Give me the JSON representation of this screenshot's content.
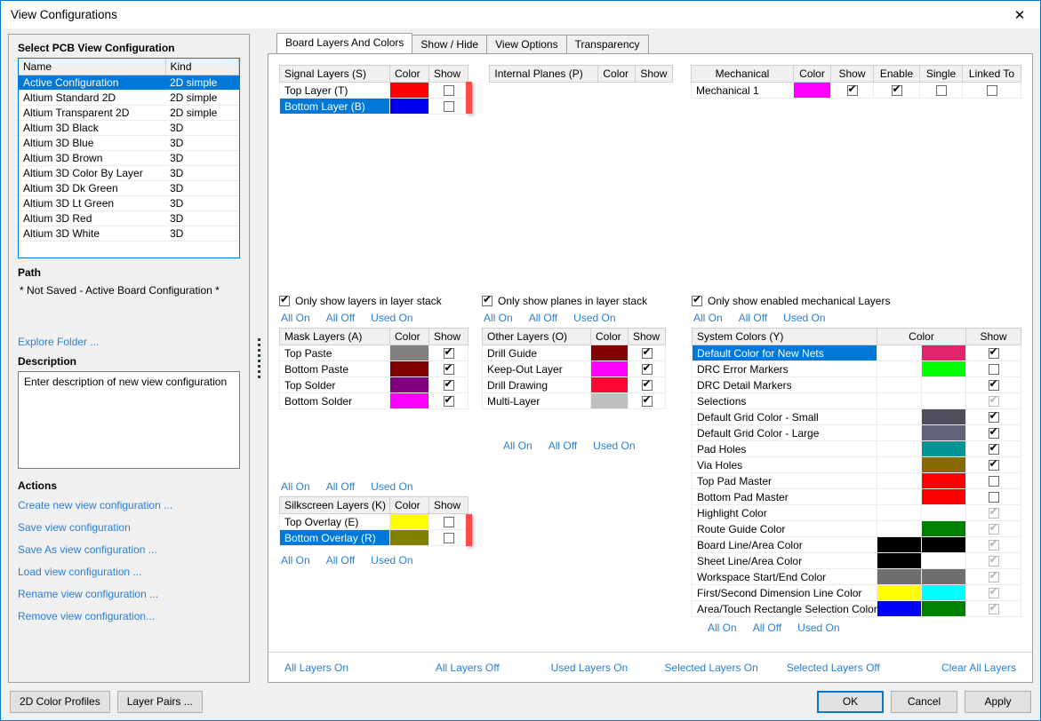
{
  "window": {
    "title": "View Configurations",
    "close_icon": "close-icon"
  },
  "left": {
    "select_label": "Select PCB View Configuration",
    "columns": [
      "Name",
      "Kind"
    ],
    "configs": [
      {
        "name": "Active Configuration",
        "kind": "2D simple",
        "selected": true
      },
      {
        "name": "Altium Standard 2D",
        "kind": "2D simple",
        "selected": false
      },
      {
        "name": "Altium Transparent 2D",
        "kind": "2D simple",
        "selected": false
      },
      {
        "name": "Altium 3D Black",
        "kind": "3D",
        "selected": false
      },
      {
        "name": "Altium 3D Blue",
        "kind": "3D",
        "selected": false
      },
      {
        "name": "Altium 3D Brown",
        "kind": "3D",
        "selected": false
      },
      {
        "name": "Altium 3D Color By Layer",
        "kind": "3D",
        "selected": false
      },
      {
        "name": "Altium 3D Dk Green",
        "kind": "3D",
        "selected": false
      },
      {
        "name": "Altium 3D Lt Green",
        "kind": "3D",
        "selected": false
      },
      {
        "name": "Altium 3D Red",
        "kind": "3D",
        "selected": false
      },
      {
        "name": "Altium 3D White",
        "kind": "3D",
        "selected": false
      }
    ],
    "path_label": "Path",
    "path_value": "* Not Saved - Active Board Configuration *",
    "explore_folder": "Explore Folder ...",
    "description_label": "Description",
    "description_value": "Enter description of new view configuration",
    "actions_label": "Actions",
    "actions": [
      "Create new view configuration ...",
      "Save view configuration",
      "Save As view configuration ...",
      "Load view configuration ...",
      "Rename view configuration ...",
      "Remove view configuration..."
    ]
  },
  "tabs": [
    {
      "label": "Board Layers And Colors",
      "active": true
    },
    {
      "label": "Show / Hide",
      "active": false
    },
    {
      "label": "View Options",
      "active": false
    },
    {
      "label": "Transparency",
      "active": false
    }
  ],
  "signal": {
    "columns": [
      "Signal Layers (S)",
      "Color",
      "Show"
    ],
    "rows": [
      {
        "name": "Top Layer (T)",
        "color": "#FF0000",
        "show": false,
        "selected": false
      },
      {
        "name": "Bottom Layer (B)",
        "color": "#0000EE",
        "show": false,
        "selected": true
      }
    ],
    "only_show_label": "Only show layers in layer stack",
    "only_show_checked": true,
    "links": [
      "All On",
      "All Off",
      "Used On"
    ]
  },
  "planes": {
    "columns": [
      "Internal Planes (P)",
      "Color",
      "Show"
    ],
    "rows": [],
    "only_show_label": "Only show planes in layer stack",
    "only_show_checked": true,
    "links": [
      "All On",
      "All Off",
      "Used On"
    ]
  },
  "mechanical": {
    "columns": [
      "Mechanical",
      "Color",
      "Show",
      "Enable",
      "Single",
      "Linked To"
    ],
    "rows": [
      {
        "name": "Mechanical 1",
        "color": "#FF00FF",
        "show": true,
        "enable": true,
        "single": false,
        "linked": false
      }
    ],
    "only_show_label": "Only show enabled mechanical Layers",
    "only_show_checked": true,
    "links": [
      "All On",
      "All Off",
      "Used On"
    ]
  },
  "mask": {
    "columns": [
      "Mask Layers (A)",
      "Color",
      "Show"
    ],
    "rows": [
      {
        "name": "Top Paste",
        "color": "#808080",
        "show": true
      },
      {
        "name": "Bottom Paste",
        "color": "#800000",
        "show": true
      },
      {
        "name": "Top Solder",
        "color": "#800080",
        "show": true
      },
      {
        "name": "Bottom Solder",
        "color": "#FF00FF",
        "show": true
      }
    ],
    "links": [
      "All On",
      "All Off",
      "Used On"
    ]
  },
  "other": {
    "columns": [
      "Other Layers (O)",
      "Color",
      "Show"
    ],
    "rows": [
      {
        "name": "Drill Guide",
        "color": "#800000",
        "show": true
      },
      {
        "name": "Keep-Out Layer",
        "color": "#FF00FF",
        "show": true
      },
      {
        "name": "Drill Drawing",
        "color": "#FA0A32",
        "show": true
      },
      {
        "name": "Multi-Layer",
        "color": "#C0C0C0",
        "show": true
      }
    ],
    "links": [
      "All On",
      "All Off",
      "Used On"
    ]
  },
  "silkscreen": {
    "columns": [
      "Silkscreen Layers (K)",
      "Color",
      "Show"
    ],
    "rows": [
      {
        "name": "Top Overlay (E)",
        "color": "#FFFF00",
        "show": false,
        "selected": false
      },
      {
        "name": "Bottom Overlay (R)",
        "color": "#808000",
        "show": false,
        "selected": true
      }
    ],
    "links_above": [
      "All On",
      "All Off",
      "Used On"
    ],
    "links_below": [
      "All On",
      "All Off",
      "Used On"
    ]
  },
  "system": {
    "columns": [
      "System Colors (Y)",
      "Color",
      "Show"
    ],
    "rows": [
      {
        "name": "Default Color for New Nets",
        "color1": "",
        "color2": "#E0256B",
        "show": true,
        "enabled": true,
        "selected": true
      },
      {
        "name": "DRC Error Markers",
        "color1": "",
        "color2": "#00FF00",
        "show": false,
        "enabled": true,
        "selected": false
      },
      {
        "name": "DRC Detail Markers",
        "color1": "",
        "color2": "",
        "show": true,
        "enabled": true,
        "selected": false
      },
      {
        "name": "Selections",
        "color1": "",
        "color2": "",
        "show": true,
        "enabled": false,
        "selected": false
      },
      {
        "name": "Default Grid Color - Small",
        "color1": "",
        "color2": "#4E4E5C",
        "show": true,
        "enabled": true,
        "selected": false
      },
      {
        "name": "Default Grid Color - Large",
        "color1": "",
        "color2": "#62637A",
        "show": true,
        "enabled": true,
        "selected": false
      },
      {
        "name": "Pad Holes",
        "color1": "",
        "color2": "#009696",
        "show": true,
        "enabled": true,
        "selected": false
      },
      {
        "name": "Via Holes",
        "color1": "",
        "color2": "#876B00",
        "show": true,
        "enabled": true,
        "selected": false
      },
      {
        "name": "Top Pad Master",
        "color1": "",
        "color2": "#FF0000",
        "show": false,
        "enabled": true,
        "selected": false
      },
      {
        "name": "Bottom Pad Master",
        "color1": "",
        "color2": "#FF0000",
        "show": false,
        "enabled": true,
        "selected": false
      },
      {
        "name": "Highlight Color",
        "color1": "",
        "color2": "",
        "show": true,
        "enabled": false,
        "selected": false
      },
      {
        "name": "Route Guide Color",
        "color1": "",
        "color2": "#008000",
        "show": true,
        "enabled": false,
        "selected": false
      },
      {
        "name": "Board Line/Area Color",
        "color1": "#000000",
        "color2": "#000000",
        "show": true,
        "enabled": false,
        "selected": false
      },
      {
        "name": "Sheet Line/Area Color",
        "color1": "#000000",
        "color2": "",
        "show": true,
        "enabled": false,
        "selected": false
      },
      {
        "name": "Workspace Start/End Color",
        "color1": "#6E6E6E",
        "color2": "#6E6E6E",
        "show": true,
        "enabled": false,
        "selected": false
      },
      {
        "name": "First/Second Dimension Line Color",
        "color1": "#FFFF00",
        "color2": "#00FFFF",
        "show": true,
        "enabled": false,
        "selected": false
      },
      {
        "name": "Area/Touch Rectangle Selection Color",
        "color1": "#0000FF",
        "color2": "#008000",
        "show": true,
        "enabled": false,
        "selected": false
      }
    ],
    "links": [
      "All On",
      "All Off",
      "Used On"
    ]
  },
  "bottom_links": [
    "All Layers On",
    "All Layers Off",
    "Used Layers On",
    "Selected Layers On",
    "Selected Layers Off",
    "Clear All Layers"
  ],
  "footer": {
    "color_profiles": "2D Color Profiles",
    "layer_pairs": "Layer Pairs ...",
    "ok": "OK",
    "cancel": "Cancel",
    "apply": "Apply"
  },
  "accent": "#0078d7",
  "link_color": "#2a7fd4"
}
